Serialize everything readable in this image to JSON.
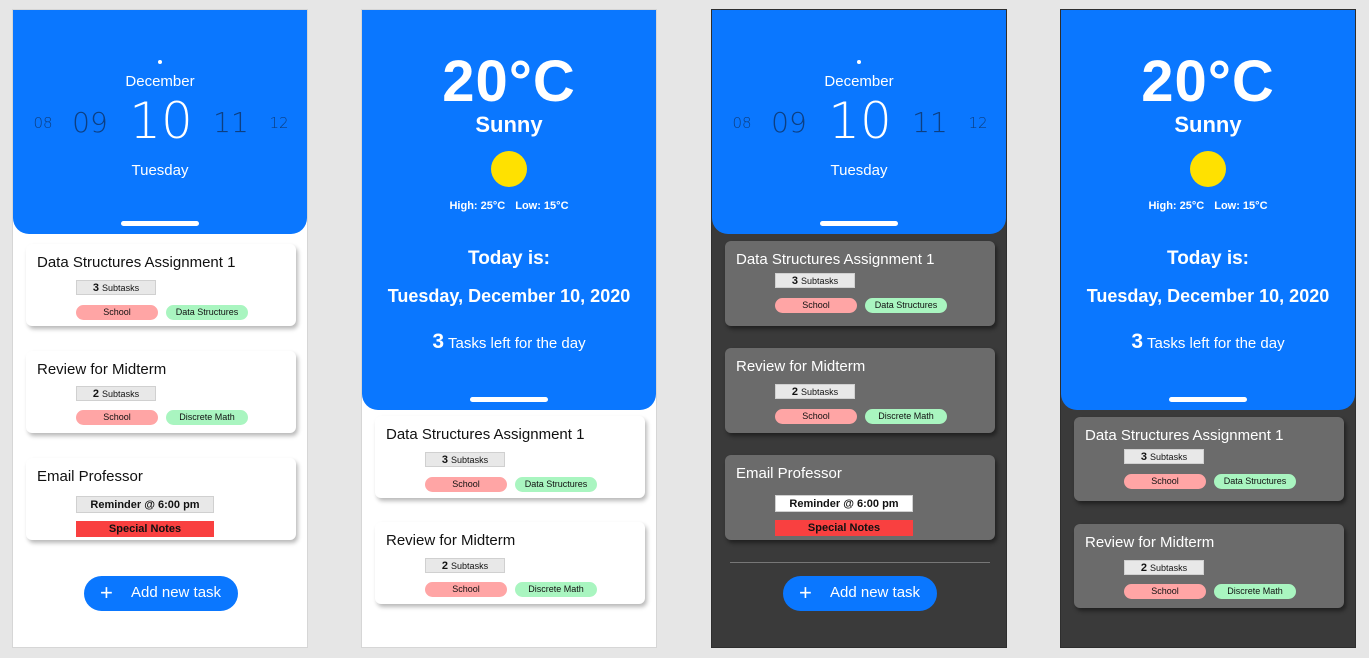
{
  "date_picker": {
    "month": "December",
    "days": [
      "08",
      "09",
      "10",
      "11",
      "12"
    ],
    "weekday": "Tuesday"
  },
  "weather": {
    "temperature": "20°C",
    "condition": "Sunny",
    "high": "High: 25°C",
    "low": "Low: 15°C",
    "today_label": "Today is:",
    "full_date": "Tuesday, December 10, 2020",
    "tasks_count": "3",
    "tasks_left_text": "Tasks left for the day"
  },
  "tasks": [
    {
      "title": "Data Structures Assignment 1",
      "subtask_count": "3",
      "subtask_label": "Subtasks",
      "tags": [
        "School",
        "Data Structures"
      ]
    },
    {
      "title": "Review for Midterm",
      "subtask_count": "2",
      "subtask_label": "Subtasks",
      "tags": [
        "School",
        "Discrete Math"
      ]
    },
    {
      "title": "Email Professor",
      "reminder": "Reminder @ 6:00 pm",
      "notes": "Special Notes"
    }
  ],
  "add_task_label": "Add new task",
  "colors": {
    "accent": "#0a77ff",
    "sun": "#ffe100",
    "school_tag": "#ffa5a5",
    "course_tag": "#a9f5c0",
    "notes": "#f94040",
    "dark_bg": "#3a3a3a",
    "dark_card": "#6b6b6b"
  }
}
